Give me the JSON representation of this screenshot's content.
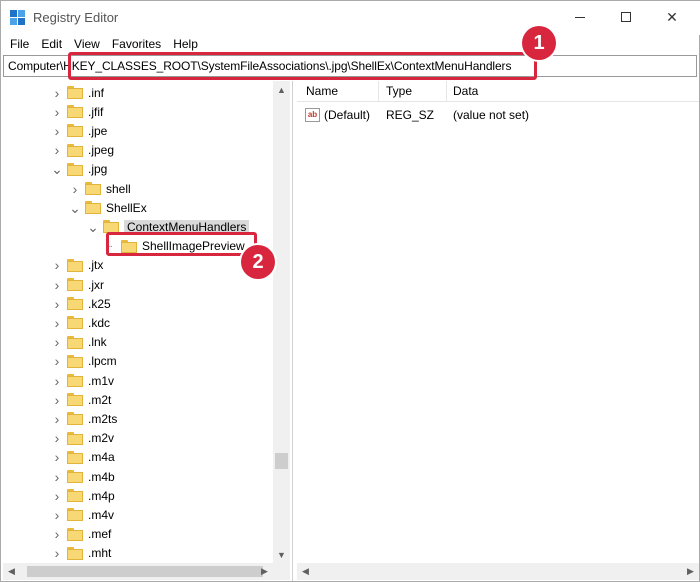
{
  "window": {
    "title": "Registry Editor",
    "controls": {
      "minimize": "minimize",
      "maximize": "maximize",
      "close": "close"
    }
  },
  "menu": [
    "File",
    "Edit",
    "View",
    "Favorites",
    "Help"
  ],
  "address": {
    "value": "Computer\\HKEY_CLASSES_ROOT\\SystemFileAssociations\\.jpg\\ShellEx\\ContextMenuHandlers"
  },
  "tree": [
    {
      "label": ".inf",
      "indent": 0,
      "expander": "collapsed"
    },
    {
      "label": ".jfif",
      "indent": 0,
      "expander": "collapsed"
    },
    {
      "label": ".jpe",
      "indent": 0,
      "expander": "collapsed"
    },
    {
      "label": ".jpeg",
      "indent": 0,
      "expander": "collapsed"
    },
    {
      "label": ".jpg",
      "indent": 0,
      "expander": "expanded"
    },
    {
      "label": "shell",
      "indent": 1,
      "expander": "collapsed"
    },
    {
      "label": "ShellEx",
      "indent": 1,
      "expander": "expanded"
    },
    {
      "label": "ContextMenuHandlers",
      "indent": 2,
      "expander": "expanded",
      "selected": true
    },
    {
      "label": "ShellImagePreview",
      "indent": 3,
      "expander": "leaf"
    },
    {
      "label": ".jtx",
      "indent": 0,
      "expander": "collapsed"
    },
    {
      "label": ".jxr",
      "indent": 0,
      "expander": "collapsed"
    },
    {
      "label": ".k25",
      "indent": 0,
      "expander": "collapsed"
    },
    {
      "label": ".kdc",
      "indent": 0,
      "expander": "collapsed"
    },
    {
      "label": ".lnk",
      "indent": 0,
      "expander": "collapsed"
    },
    {
      "label": ".lpcm",
      "indent": 0,
      "expander": "collapsed"
    },
    {
      "label": ".m1v",
      "indent": 0,
      "expander": "collapsed"
    },
    {
      "label": ".m2t",
      "indent": 0,
      "expander": "collapsed"
    },
    {
      "label": ".m2ts",
      "indent": 0,
      "expander": "collapsed"
    },
    {
      "label": ".m2v",
      "indent": 0,
      "expander": "collapsed"
    },
    {
      "label": ".m4a",
      "indent": 0,
      "expander": "collapsed"
    },
    {
      "label": ".m4b",
      "indent": 0,
      "expander": "collapsed"
    },
    {
      "label": ".m4p",
      "indent": 0,
      "expander": "collapsed"
    },
    {
      "label": ".m4v",
      "indent": 0,
      "expander": "collapsed"
    },
    {
      "label": ".mef",
      "indent": 0,
      "expander": "collapsed"
    },
    {
      "label": ".mht",
      "indent": 0,
      "expander": "collapsed"
    }
  ],
  "values_table": {
    "columns": [
      "Name",
      "Type",
      "Data"
    ],
    "rows": [
      {
        "icon": "string-value-icon",
        "name": "(Default)",
        "type": "REG_SZ",
        "data": "(value not set)"
      }
    ]
  },
  "annotations": [
    {
      "number": "1",
      "target": "address-bar"
    },
    {
      "number": "2",
      "target": "ShellImagePreview"
    }
  ],
  "colors": {
    "callout": "#d7263d",
    "folder": "#f8d775",
    "selection": "#d9d9d9"
  }
}
